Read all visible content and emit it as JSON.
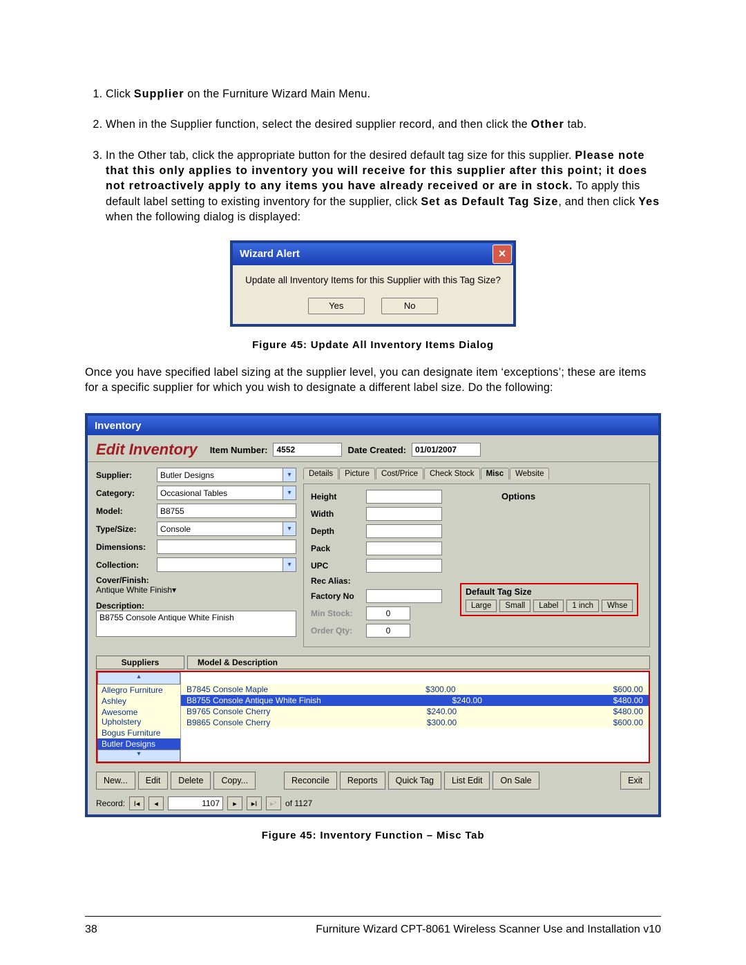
{
  "steps": {
    "s1_a": "Click ",
    "s1_b": "Supplier",
    "s1_c": " on the Furniture Wizard Main Menu.",
    "s2_a": "When in the Supplier function, select the desired supplier record, and then click the ",
    "s2_b": "Other",
    "s2_c": " tab.",
    "s3_a": "In the Other tab, click the appropriate button for the desired default tag size for this supplier. ",
    "s3_b": "Please note that this only applies to inventory you will receive for this supplier after this point; it does not retroactively apply to any items you have already received or are in stock.",
    "s3_c": " To apply this default label setting to existing inventory for the supplier, click ",
    "s3_d": "Set as Default Tag Size",
    "s3_e": ", and then click ",
    "s3_f": "Yes",
    "s3_g": " when the following dialog is displayed:"
  },
  "alert": {
    "title": "Wizard Alert",
    "msg": "Update all Inventory Items for this Supplier with this Tag Size?",
    "yes": "Yes",
    "no": "No"
  },
  "cap1": "Figure 45: Update All Inventory Items Dialog",
  "para2": "Once you have specified label sizing at the supplier level, you can designate item ‘exceptions’; these are items for a specific supplier for which you wish to designate a different label size. Do the following:",
  "inv": {
    "win": "Inventory",
    "title": "Edit Inventory",
    "itemnum_l": "Item Number:",
    "itemnum": "4552",
    "datecr_l": "Date Created:",
    "datecr": "01/01/2007",
    "fields": {
      "supplier_l": "Supplier:",
      "supplier": "Butler Designs",
      "category_l": "Category:",
      "category": "Occasional Tables",
      "model_l": "Model:",
      "model": "B8755",
      "type_l": "Type/Size:",
      "type": "Console",
      "dim_l": "Dimensions:",
      "coll_l": "Collection:",
      "cover_l": "Cover/Finish:",
      "cover": "Antique White Finish",
      "desc_l": "Description:",
      "desc": "B8755 Console Antique White Finish"
    },
    "tabs": [
      "Details",
      "Picture",
      "Cost/Price",
      "Check Stock",
      "Misc",
      "Website"
    ],
    "misc": {
      "height": "Height",
      "width": "Width",
      "depth": "Depth",
      "pack": "Pack",
      "upc": "UPC",
      "recal": "Rec Alias:",
      "fact": "Factory No",
      "min": "Min Stock:",
      "ord": "Order Qty:",
      "zero": "0",
      "opts": "Options",
      "tag_l": "Default Tag Size",
      "tag": [
        "Large",
        "Small",
        "Label",
        "1 inch",
        "Whse"
      ]
    },
    "sbar": [
      "Suppliers",
      "Model & Description"
    ],
    "suppliers": [
      "Allegro Furniture",
      "Ashley",
      "Awesome Upholstery",
      "Bogus Furniture",
      "Butler Designs"
    ],
    "rows": [
      {
        "m": "B7845 Console Maple",
        "p1": "$300.00",
        "p2": "$600.00"
      },
      {
        "m": "B8755 Console Antique White Finish",
        "p1": "$240.00",
        "p2": "$480.00"
      },
      {
        "m": "B9765 Console Cherry",
        "p1": "$240.00",
        "p2": "$480.00"
      },
      {
        "m": "B9865 Console Cherry",
        "p1": "$300.00",
        "p2": "$600.00"
      }
    ],
    "btns": [
      "New...",
      "Edit",
      "Delete",
      "Copy...",
      "Reconcile",
      "Reports",
      "Quick Tag",
      "List Edit",
      "On Sale",
      "Exit"
    ],
    "rec_l": "Record:",
    "rec_cur": "1107",
    "rec_tot": "of  1127"
  },
  "cap2": "Figure 45: Inventory Function – Misc Tab",
  "footer": {
    "page": "38",
    "title": "Furniture Wizard CPT-8061 Wireless Scanner Use and Installation v10"
  }
}
